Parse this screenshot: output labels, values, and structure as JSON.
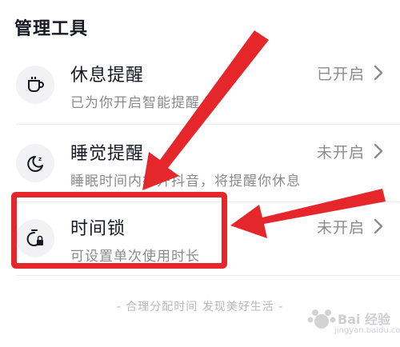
{
  "header": {
    "title": "管理工具"
  },
  "items": [
    {
      "title": "休息提醒",
      "subtitle": "已为你开启智能提醒",
      "status": "已开启",
      "icon": "coffee-cup-icon"
    },
    {
      "title": "睡觉提醒",
      "subtitle": "睡眠时间内打开抖音，将提醒你休息",
      "status": "未开启",
      "icon": "moon-icon"
    },
    {
      "title": "时间锁",
      "subtitle": "可设置单次使用时长",
      "status": "未开启",
      "icon": "time-lock-icon"
    }
  ],
  "footer": {
    "text": "- 合理分配时间 发现美好生活 -"
  },
  "watermark": {
    "text": "Bai 经验",
    "url": "jingyan.baidu.com"
  },
  "colors": {
    "annotation_red": "#e5262b",
    "text_primary": "#161823",
    "text_secondary": "#8a8b91"
  }
}
